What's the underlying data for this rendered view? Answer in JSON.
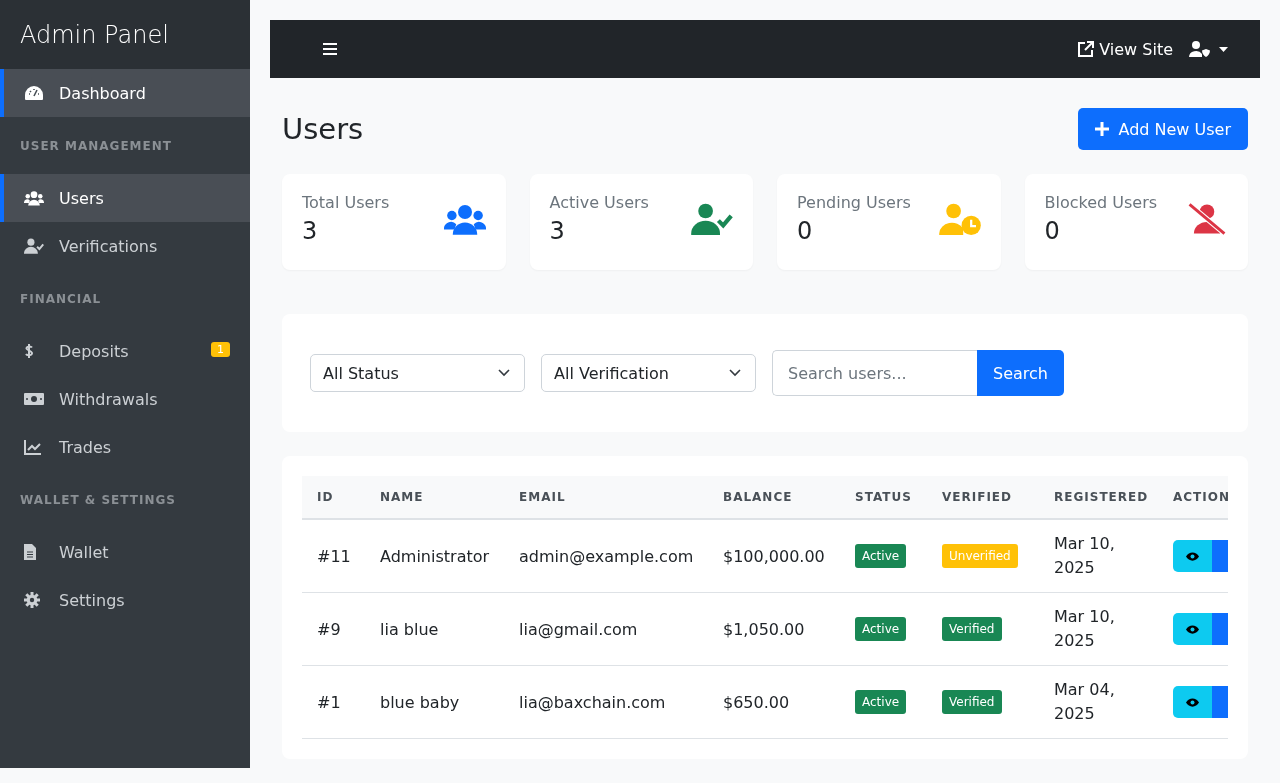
{
  "sidebar": {
    "title": "Admin Panel",
    "sections": [
      {
        "items": [
          {
            "label": "Dashboard",
            "selected": true
          }
        ]
      },
      {
        "heading": "USER MANAGEMENT",
        "items": [
          {
            "label": "Users",
            "selected": true
          },
          {
            "label": "Verifications",
            "selected": false
          }
        ]
      },
      {
        "heading": "FINANCIAL",
        "items": [
          {
            "label": "Deposits",
            "selected": false,
            "badge": "1"
          },
          {
            "label": "Withdrawals",
            "selected": false
          },
          {
            "label": "Trades",
            "selected": false
          }
        ]
      },
      {
        "heading": "WALLET & SETTINGS",
        "items": [
          {
            "label": "Wallet",
            "selected": false
          },
          {
            "label": "Settings",
            "selected": false
          }
        ]
      }
    ]
  },
  "topbar": {
    "view_site": "View Site"
  },
  "page": {
    "title": "Users",
    "add_button": "Add New User"
  },
  "stats": [
    {
      "label": "Total Users",
      "value": "3",
      "color": "#0d6efd"
    },
    {
      "label": "Active Users",
      "value": "3",
      "color": "#198754"
    },
    {
      "label": "Pending Users",
      "value": "0",
      "color": "#ffc107"
    },
    {
      "label": "Blocked Users",
      "value": "0",
      "color": "#dc3545"
    }
  ],
  "filters": {
    "status": "All Status",
    "verification": "All Verification",
    "search_placeholder": "Search users...",
    "search_button": "Search"
  },
  "table": {
    "columns": [
      "ID",
      "NAME",
      "EMAIL",
      "BALANCE",
      "STATUS",
      "VERIFIED",
      "REGISTERED",
      "ACTION"
    ],
    "rows": [
      {
        "id": "#11",
        "name": "Administrator",
        "email": "admin@example.com",
        "balance": "$100,000.00",
        "status": "Active",
        "active": true,
        "verified_label": "Unverified",
        "verified": false,
        "registered": "Mar 10, 2025"
      },
      {
        "id": "#9",
        "name": "lia blue",
        "email": "lia@gmail.com",
        "balance": "$1,050.00",
        "status": "Active",
        "active": true,
        "verified_label": "Verified",
        "verified": true,
        "registered": "Mar 10, 2025"
      },
      {
        "id": "#1",
        "name": "blue baby",
        "email": "lia@baxchain.com",
        "balance": "$650.00",
        "status": "Active",
        "active": true,
        "verified_label": "Verified",
        "verified": true,
        "registered": "Mar 04, 2025"
      }
    ]
  }
}
